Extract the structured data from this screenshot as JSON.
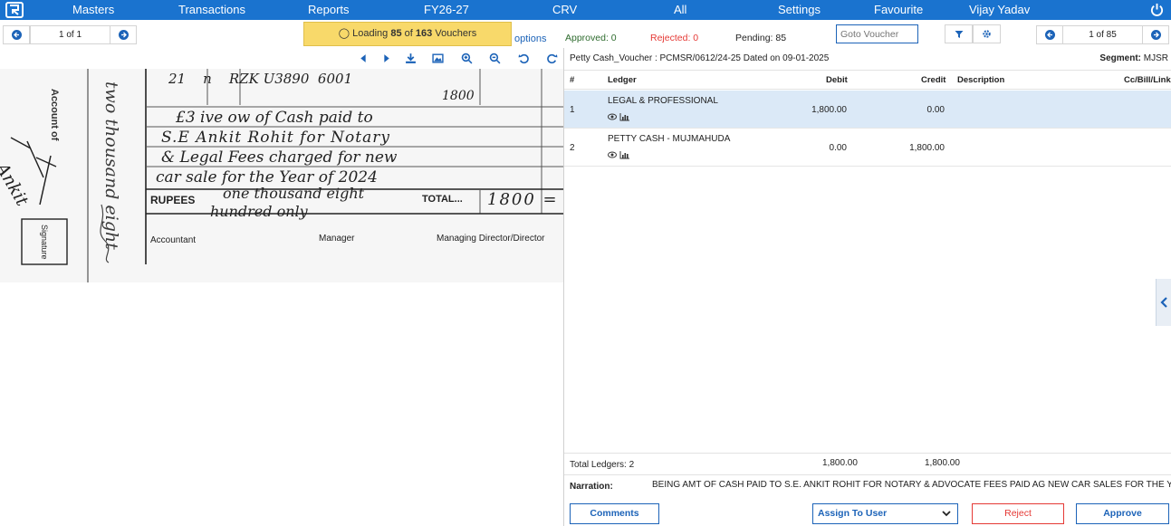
{
  "nav": {
    "items": [
      "Masters",
      "Transactions",
      "Reports",
      "FY26-27",
      "CRV",
      "All",
      "Settings",
      "Favourite",
      "Vijay Yadav"
    ]
  },
  "left_pager": {
    "text": "1 of 1"
  },
  "loading": {
    "prefix": "Loading",
    "current": "85",
    "of": "of",
    "total": "163",
    "suffix": "Vouchers"
  },
  "options_label": "options",
  "status": {
    "approved": "Approved: 0",
    "rejected": "Rejected: 0",
    "pending": "Pending: 85",
    "rejected_color": "#e53935"
  },
  "goto": {
    "placeholder": "Goto Voucher"
  },
  "right_pager": {
    "text": "1 of 85"
  },
  "document": {
    "printed_labels": {
      "account_of": "Account of",
      "rupees": "RUPEES",
      "total": "TOTAL...",
      "accountant": "Accountant",
      "manager": "Manager",
      "director": "Managing Director/Director",
      "signature": "Signature"
    },
    "handwriting": {
      "line1": "21    n    RZK U3890  6001",
      "line2": "1800",
      "line3": "£3 ive ow of Cash paid to",
      "line4": "S.E Ankit Rohit for Notary",
      "line5": "& Legal Fees charged for new",
      "line6": "car sale for the Year of 2024",
      "line7": "one thousand eight",
      "line8": "hundred only",
      "amount": "1800 =",
      "signature_text": "Ankit",
      "side_text": "two thousand eight"
    }
  },
  "voucher": {
    "info": "Petty Cash_Voucher : PCMSR/0612/24-25  Dated on  09-01-2025",
    "segment_label": "Segment:",
    "segment_value": "MJSR"
  },
  "table": {
    "headers": [
      "#",
      "Ledger",
      "Debit",
      "Credit",
      "Description",
      "Cc/Bill/Link"
    ],
    "rows": [
      {
        "num": "1",
        "ledger": "LEGAL & PROFESSIONAL",
        "debit": "1,800.00",
        "credit": "0.00"
      },
      {
        "num": "2",
        "ledger": "PETTY CASH - MUJMAHUDA",
        "debit": "0.00",
        "credit": "1,800.00"
      }
    ]
  },
  "totals": {
    "label": "Total Ledgers: 2",
    "debit": "1,800.00",
    "credit": "1,800.00"
  },
  "narration": {
    "label": "Narration:",
    "text": "BEING AMT OF CASH PAID TO S.E. ANKIT ROHIT FOR NOTARY & ADVOCATE FEES PAID AG NEW CAR SALES FOR THE YEAR ..."
  },
  "footer": {
    "comments": "Comments",
    "assign": "Assign To User",
    "reject": "Reject",
    "approve": "Approve"
  },
  "colors": {
    "brand": "#1a73cf",
    "selected_row": "#dbe9f7",
    "loading_bg": "#f8d96a",
    "reject": "#e53935"
  },
  "icons": [
    "logo-icon",
    "power-icon",
    "prev-icon",
    "next-icon",
    "download-icon",
    "image-icon",
    "zoom-in-icon",
    "zoom-out-icon",
    "rotate-left-icon",
    "rotate-right-icon",
    "filter-icon",
    "gear-icon",
    "eye-icon",
    "chart-icon",
    "chevron-down-icon",
    "collapse-left-icon"
  ]
}
